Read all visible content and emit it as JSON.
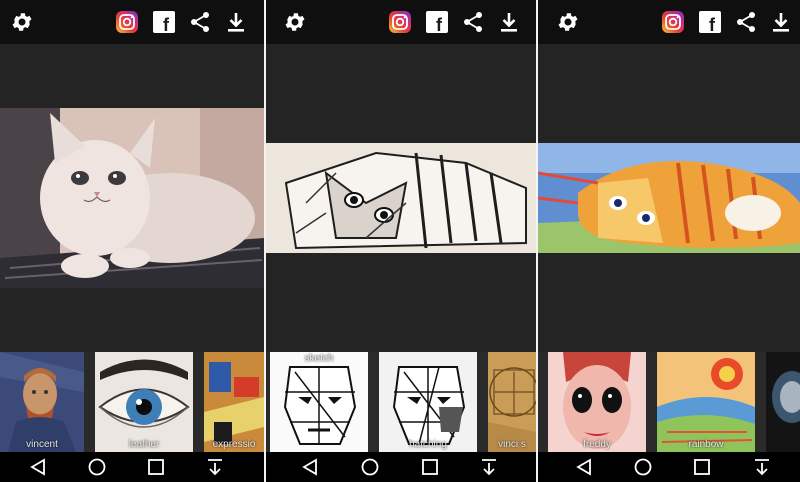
{
  "panels": [
    {
      "filters": [
        {
          "label": "vincent",
          "icon": "van-gogh-portrait-thumbnail"
        },
        {
          "label": "leather",
          "icon": "eye-illustration-thumbnail"
        },
        {
          "label": "expressio",
          "icon": "abstract-expression-thumbnail"
        }
      ]
    },
    {
      "filters": [
        {
          "label": "sketch",
          "icon": "sketch-face-thumbnail"
        },
        {
          "label": "hatching",
          "icon": "hatching-face-thumbnail"
        },
        {
          "label": "vinci s",
          "icon": "vinci-sketch-thumbnail"
        }
      ]
    },
    {
      "filters": [
        {
          "label": "freddy",
          "icon": "freddy-face-thumbnail"
        },
        {
          "label": "rainbow",
          "icon": "rainbow-landscape-thumbnail"
        },
        {
          "label": "",
          "icon": "dark-portrait-thumbnail"
        }
      ]
    }
  ],
  "toolbar": {
    "icons": [
      "settings-gear-icon",
      "instagram-icon",
      "facebook-icon",
      "share-icon",
      "download-icon"
    ],
    "facebook_glyph": "f"
  },
  "nav": {
    "icons": [
      "back-triangle-icon",
      "home-circle-icon",
      "recents-square-icon",
      "hide-keyboard-icon"
    ]
  },
  "colors": {
    "topbar": "#0f0f0f",
    "panel_bg": "#242424",
    "navbar": "#000000"
  }
}
